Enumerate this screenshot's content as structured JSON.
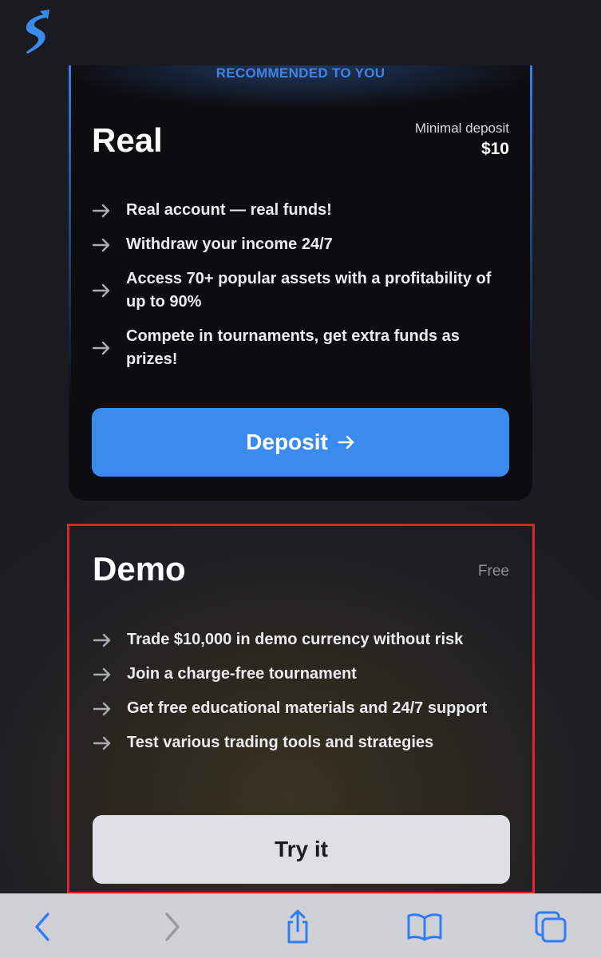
{
  "app": {
    "logo_icon": "lightning-s-logo-icon",
    "accent_color": "#3b8bef",
    "highlight_color": "#e3222a"
  },
  "real_card": {
    "badge": "RECOMMENDED TO YOU",
    "title": "Real",
    "deposit_label": "Minimal deposit",
    "deposit_amount": "$10",
    "features": [
      "Real account — real funds!",
      "Withdraw your income 24/7",
      "Access 70+ popular assets with a profitability of up to 90%",
      "Compete in tournaments, get extra funds as prizes!"
    ],
    "button_label": "Deposit"
  },
  "demo_card": {
    "title": "Demo",
    "price_label": "Free",
    "features": [
      "Trade $10,000 in demo currency without risk",
      "Join a charge-free tournament",
      "Get free educational materials and 24/7 support",
      "Test various trading tools and strategies"
    ],
    "button_label": "Try it"
  },
  "toolbar": {
    "icons": [
      "back-icon",
      "forward-icon",
      "share-icon",
      "bookmarks-icon",
      "tabs-icon"
    ]
  }
}
